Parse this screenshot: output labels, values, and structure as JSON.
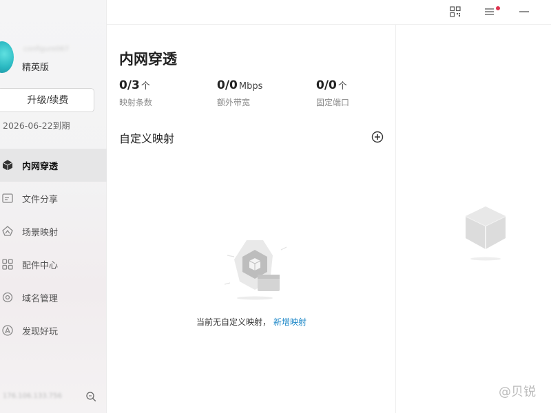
{
  "user": {
    "name": "configure067",
    "plan": "精英版",
    "upgrade_label": "升级/续费",
    "expire": "2026-06-22到期"
  },
  "nav": {
    "items": [
      {
        "label": "内网穿透",
        "icon": "cube-icon",
        "active": true
      },
      {
        "label": "文件分享",
        "icon": "folder-share-icon"
      },
      {
        "label": "场景映射",
        "icon": "scene-map-icon"
      },
      {
        "label": "配件中心",
        "icon": "grid-apps-icon"
      },
      {
        "label": "域名管理",
        "icon": "domain-icon"
      },
      {
        "label": "发现好玩",
        "icon": "compass-icon"
      }
    ]
  },
  "sidebar_footer": {
    "version": "176.106.133.756"
  },
  "topbar": {
    "icons": [
      "qrcode-icon",
      "menu-icon",
      "minimize-icon"
    ]
  },
  "main": {
    "title": "内网穿透",
    "stats": [
      {
        "value": "0/3",
        "unit": "个",
        "label": "映射条数"
      },
      {
        "value": "0/0",
        "unit": "Mbps",
        "label": "额外带宽"
      },
      {
        "value": "0/0",
        "unit": "个",
        "label": "固定端口"
      }
    ],
    "section_title": "自定义映射",
    "empty_text": "当前无自定义映射，",
    "empty_link": "新增映射"
  },
  "watermark": "@贝锐"
}
